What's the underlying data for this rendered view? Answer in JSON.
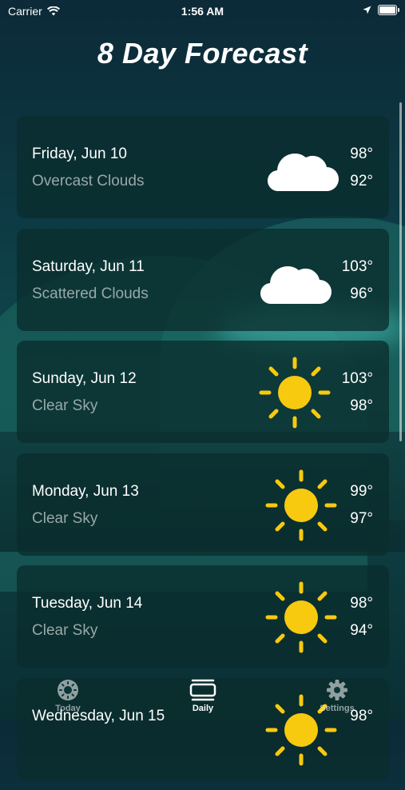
{
  "status_bar": {
    "carrier": "Carrier",
    "time": "1:56 AM"
  },
  "title": "8 Day Forecast",
  "forecast": [
    {
      "day": "Friday, Jun 10",
      "condition": "Overcast Clouds",
      "high": "98°",
      "low": "92°",
      "icon": "cloud-icon"
    },
    {
      "day": "Saturday, Jun 11",
      "condition": "Scattered Clouds",
      "high": "103°",
      "low": "96°",
      "icon": "cloud-icon"
    },
    {
      "day": "Sunday, Jun 12",
      "condition": "Clear Sky",
      "high": "103°",
      "low": "98°",
      "icon": "sun-icon"
    },
    {
      "day": "Monday, Jun 13",
      "condition": "Clear Sky",
      "high": "99°",
      "low": "97°",
      "icon": "sun-icon"
    },
    {
      "day": "Tuesday, Jun 14",
      "condition": "Clear Sky",
      "high": "98°",
      "low": "94°",
      "icon": "sun-icon"
    },
    {
      "day": "Wednesday, Jun 15",
      "condition": "",
      "high": "98°",
      "low": "",
      "icon": "sun-icon"
    }
  ],
  "tab_bar": {
    "items": [
      {
        "label": "Today",
        "icon": "sun-circle-icon",
        "active": false
      },
      {
        "label": "Daily",
        "icon": "list-icon",
        "active": true
      },
      {
        "label": "Settings",
        "icon": "gear-icon",
        "active": false
      }
    ]
  },
  "colors": {
    "sun": "#f7c90f",
    "cloud": "#ffffff",
    "card_bg": "#0a2d2d",
    "secondary_text": "#9aa7a8"
  }
}
